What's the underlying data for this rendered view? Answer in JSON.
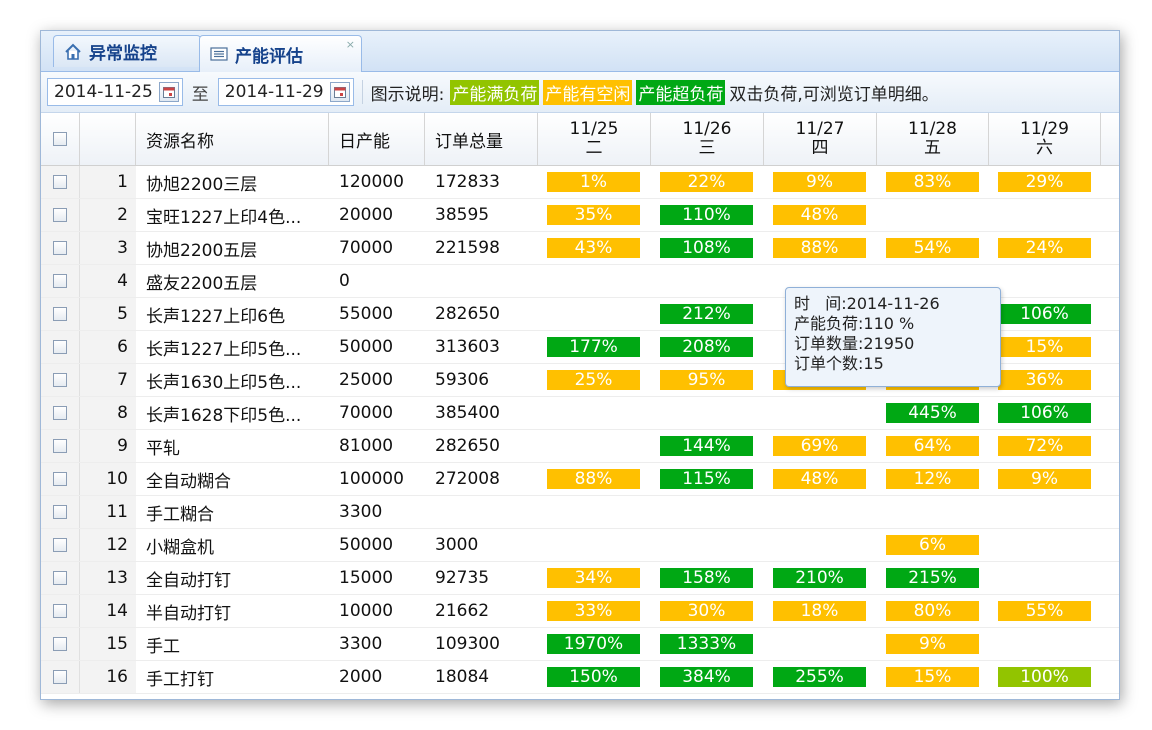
{
  "tabs": [
    {
      "label": "异常监控",
      "icon": "home-icon"
    },
    {
      "label": "产能评估",
      "icon": "list-icon",
      "close": "×"
    }
  ],
  "toolbar": {
    "start_date": "2014-11-25",
    "to": "至",
    "end_date": "2014-11-29",
    "legend_title": "图示说明:",
    "legend": [
      {
        "label": "产能满负荷",
        "color": "#92c400"
      },
      {
        "label": "产能有空闲",
        "color": "#ffc000"
      },
      {
        "label": "产能超负荷",
        "color": "#00a814"
      }
    ],
    "hint": "双击负荷,可浏览订单明细。"
  },
  "columns": {
    "name": "资源名称",
    "capacity": "日产能",
    "orders": "订单总量",
    "days": [
      {
        "date": "11/25",
        "weekday": "二"
      },
      {
        "date": "11/26",
        "weekday": "三"
      },
      {
        "date": "11/27",
        "weekday": "四"
      },
      {
        "date": "11/28",
        "weekday": "五"
      },
      {
        "date": "11/29",
        "weekday": "六"
      }
    ]
  },
  "colors": {
    "idle": "#ffc000",
    "over": "#00a814",
    "full": "#92c400"
  },
  "rows": [
    {
      "num": "1",
      "name": "协旭2200三层",
      "capacity": "120000",
      "orders": "172833",
      "loads": [
        {
          "v": "1%",
          "s": "y"
        },
        {
          "v": "22%",
          "s": "y"
        },
        {
          "v": "9%",
          "s": "y"
        },
        {
          "v": "83%",
          "s": "y"
        },
        {
          "v": "29%",
          "s": "y"
        }
      ]
    },
    {
      "num": "2",
      "name": "宝旺1227上印4色...",
      "capacity": "20000",
      "orders": "38595",
      "loads": [
        {
          "v": "35%",
          "s": "y"
        },
        {
          "v": "110%",
          "s": "g"
        },
        {
          "v": "48%",
          "s": "y"
        },
        null,
        null
      ]
    },
    {
      "num": "3",
      "name": "协旭2200五层",
      "capacity": "70000",
      "orders": "221598",
      "loads": [
        {
          "v": "43%",
          "s": "y"
        },
        {
          "v": "108%",
          "s": "g"
        },
        {
          "v": "88%",
          "s": "y"
        },
        {
          "v": "54%",
          "s": "y"
        },
        {
          "v": "24%",
          "s": "y"
        }
      ]
    },
    {
      "num": "4",
      "name": "盛友2200五层",
      "capacity": "0",
      "orders": "",
      "loads": [
        null,
        null,
        null,
        null,
        null
      ]
    },
    {
      "num": "5",
      "name": "长声1227上印6色",
      "capacity": "55000",
      "orders": "282650",
      "loads": [
        null,
        {
          "v": "212%",
          "s": "g"
        },
        null,
        {
          "v": "",
          "s": "y"
        },
        {
          "v": "106%",
          "s": "g"
        }
      ]
    },
    {
      "num": "6",
      "name": "长声1227上印5色...",
      "capacity": "50000",
      "orders": "313603",
      "loads": [
        {
          "v": "177%",
          "s": "g"
        },
        {
          "v": "208%",
          "s": "g"
        },
        null,
        {
          "v": "",
          "s": "y"
        },
        {
          "v": "15%",
          "s": "y"
        }
      ]
    },
    {
      "num": "7",
      "name": "长声1630上印5色...",
      "capacity": "25000",
      "orders": "59306",
      "loads": [
        {
          "v": "25%",
          "s": "y"
        },
        {
          "v": "95%",
          "s": "y"
        },
        {
          "v": "54%",
          "s": "y"
        },
        {
          "v": "27%",
          "s": "y"
        },
        {
          "v": "36%",
          "s": "y"
        }
      ]
    },
    {
      "num": "8",
      "name": "长声1628下印5色...",
      "capacity": "70000",
      "orders": "385400",
      "loads": [
        null,
        null,
        null,
        {
          "v": "445%",
          "s": "g"
        },
        {
          "v": "106%",
          "s": "g"
        }
      ]
    },
    {
      "num": "9",
      "name": "平轧",
      "capacity": "81000",
      "orders": "282650",
      "loads": [
        null,
        {
          "v": "144%",
          "s": "g"
        },
        {
          "v": "69%",
          "s": "y"
        },
        {
          "v": "64%",
          "s": "y"
        },
        {
          "v": "72%",
          "s": "y"
        }
      ]
    },
    {
      "num": "10",
      "name": "全自动糊合",
      "capacity": "100000",
      "orders": "272008",
      "loads": [
        {
          "v": "88%",
          "s": "y"
        },
        {
          "v": "115%",
          "s": "g"
        },
        {
          "v": "48%",
          "s": "y"
        },
        {
          "v": "12%",
          "s": "y"
        },
        {
          "v": "9%",
          "s": "y"
        }
      ]
    },
    {
      "num": "11",
      "name": "手工糊合",
      "capacity": "3300",
      "orders": "",
      "loads": [
        null,
        null,
        null,
        null,
        null
      ]
    },
    {
      "num": "12",
      "name": "小糊盒机",
      "capacity": "50000",
      "orders": "3000",
      "loads": [
        null,
        null,
        null,
        {
          "v": "6%",
          "s": "y"
        },
        null
      ]
    },
    {
      "num": "13",
      "name": "全自动打钉",
      "capacity": "15000",
      "orders": "92735",
      "loads": [
        {
          "v": "34%",
          "s": "y"
        },
        {
          "v": "158%",
          "s": "g"
        },
        {
          "v": "210%",
          "s": "g"
        },
        {
          "v": "215%",
          "s": "g"
        },
        null
      ]
    },
    {
      "num": "14",
      "name": "半自动打钉",
      "capacity": "10000",
      "orders": "21662",
      "loads": [
        {
          "v": "33%",
          "s": "y"
        },
        {
          "v": "30%",
          "s": "y"
        },
        {
          "v": "18%",
          "s": "y"
        },
        {
          "v": "80%",
          "s": "y"
        },
        {
          "v": "55%",
          "s": "y"
        }
      ]
    },
    {
      "num": "15",
      "name": "手工",
      "capacity": "3300",
      "orders": "109300",
      "loads": [
        {
          "v": "1970%",
          "s": "g"
        },
        {
          "v": "1333%",
          "s": "g"
        },
        null,
        {
          "v": "9%",
          "s": "y"
        },
        null
      ]
    },
    {
      "num": "16",
      "name": "手工打钉",
      "capacity": "2000",
      "orders": "18084",
      "loads": [
        {
          "v": "150%",
          "s": "g"
        },
        {
          "v": "384%",
          "s": "g"
        },
        {
          "v": "255%",
          "s": "g"
        },
        {
          "v": "15%",
          "s": "y"
        },
        {
          "v": "100%",
          "s": "lg"
        }
      ]
    }
  ],
  "tooltip": {
    "time_label": "时   间:",
    "time_value": "2014-11-26",
    "load_label": "产能负荷:",
    "load_value": "110 %",
    "qty_label": "订单数量:",
    "qty_value": "21950",
    "count_label": "订单个数:",
    "count_value": "15"
  }
}
